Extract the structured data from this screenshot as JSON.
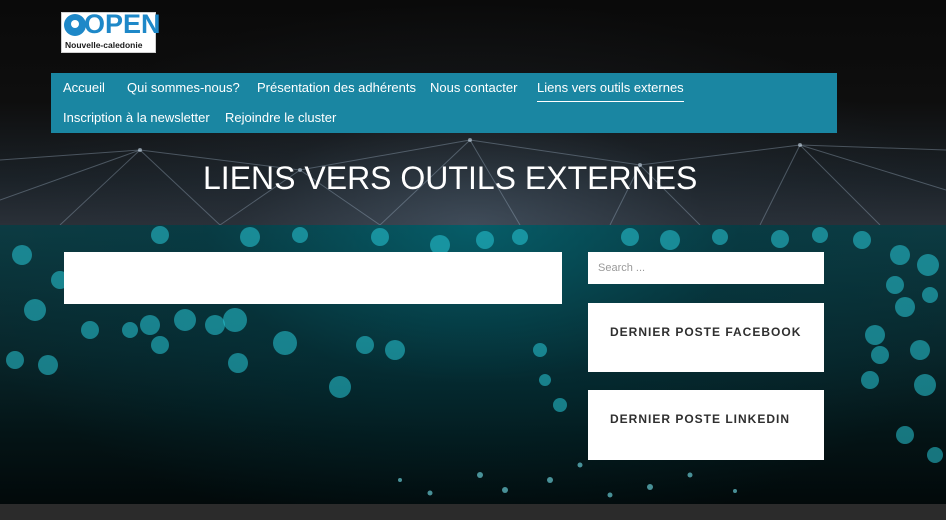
{
  "logo": {
    "word": "OPEN",
    "subtitle": "Nouvelle-caledonie"
  },
  "nav": {
    "items": [
      {
        "label": "Accueil"
      },
      {
        "label": "Qui sommes-nous?"
      },
      {
        "label": "Présentation des adhérents"
      },
      {
        "label": "Nous contacter"
      },
      {
        "label": "Liens vers outils externes",
        "active": true
      },
      {
        "label": "Inscription à la newsletter"
      },
      {
        "label": "Rejoindre le cluster"
      }
    ]
  },
  "page": {
    "title": "LIENS VERS OUTILS EXTERNES"
  },
  "sidebar": {
    "search": {
      "placeholder": "Search ..."
    },
    "widgets": [
      {
        "title": "DERNIER POSTE FACEBOOK"
      },
      {
        "title": "DERNIER POSTE LINKEDIN"
      }
    ]
  },
  "colors": {
    "nav_bg": "#1a86a2",
    "logo_blue": "#1e88c8",
    "footer": "#2b2b2b"
  }
}
